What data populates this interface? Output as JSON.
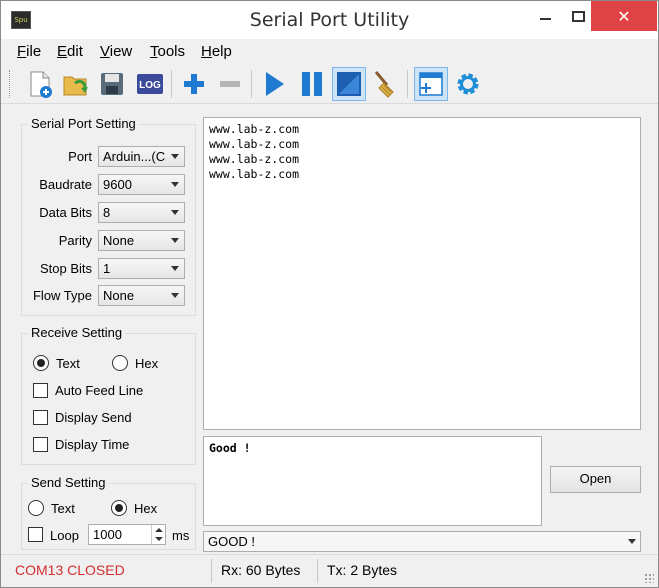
{
  "window": {
    "title": "Serial Port Utility",
    "icon_text": "Spu"
  },
  "menu": [
    {
      "accel": "F",
      "rest": "ile"
    },
    {
      "accel": "E",
      "rest": "dit"
    },
    {
      "accel": "V",
      "rest": "iew"
    },
    {
      "accel": "T",
      "rest": "ools"
    },
    {
      "accel": "H",
      "rest": "elp"
    }
  ],
  "toolbar": {
    "icons": [
      "new-file-icon",
      "open-folder-icon",
      "save-icon",
      "log-icon",
      "add-icon",
      "remove-icon",
      "play-icon",
      "pause-icon",
      "fullscreen-icon",
      "broom-icon",
      "window-layout-icon",
      "settings-gear-icon"
    ],
    "log_text": "LOG",
    "accent_blue": "#1e7bd1"
  },
  "serial_port_setting": {
    "title": "Serial Port Setting",
    "fields": [
      {
        "label": "Port",
        "value": "Arduin...(C"
      },
      {
        "label": "Baudrate",
        "value": "9600"
      },
      {
        "label": "Data Bits",
        "value": "8"
      },
      {
        "label": "Parity",
        "value": "None"
      },
      {
        "label": "Stop Bits",
        "value": "1"
      },
      {
        "label": "Flow Type",
        "value": "None"
      }
    ]
  },
  "receive_setting": {
    "title": "Receive Setting",
    "text_label": "Text",
    "hex_label": "Hex",
    "selected": "Text",
    "auto_feed_line": "Auto Feed Line",
    "display_send": "Display Send",
    "display_time": "Display Time"
  },
  "send_setting": {
    "title": "Send Setting",
    "text_label": "Text",
    "hex_label": "Hex",
    "selected": "Hex",
    "loop_label": "Loop",
    "loop_value": "1000",
    "ms_label": "ms"
  },
  "receive_area": {
    "lines": [
      "www.lab-z.com",
      "www.lab-z.com",
      "www.lab-z.com",
      "www.lab-z.com"
    ]
  },
  "send_area": {
    "text": "Good !"
  },
  "open_button": "Open",
  "history_combo": "GOOD !",
  "status": {
    "port": "COM13 CLOSED",
    "port_color": "#d32f2f",
    "rx": "Rx: 60 Bytes",
    "tx": "Tx: 2 Bytes"
  }
}
